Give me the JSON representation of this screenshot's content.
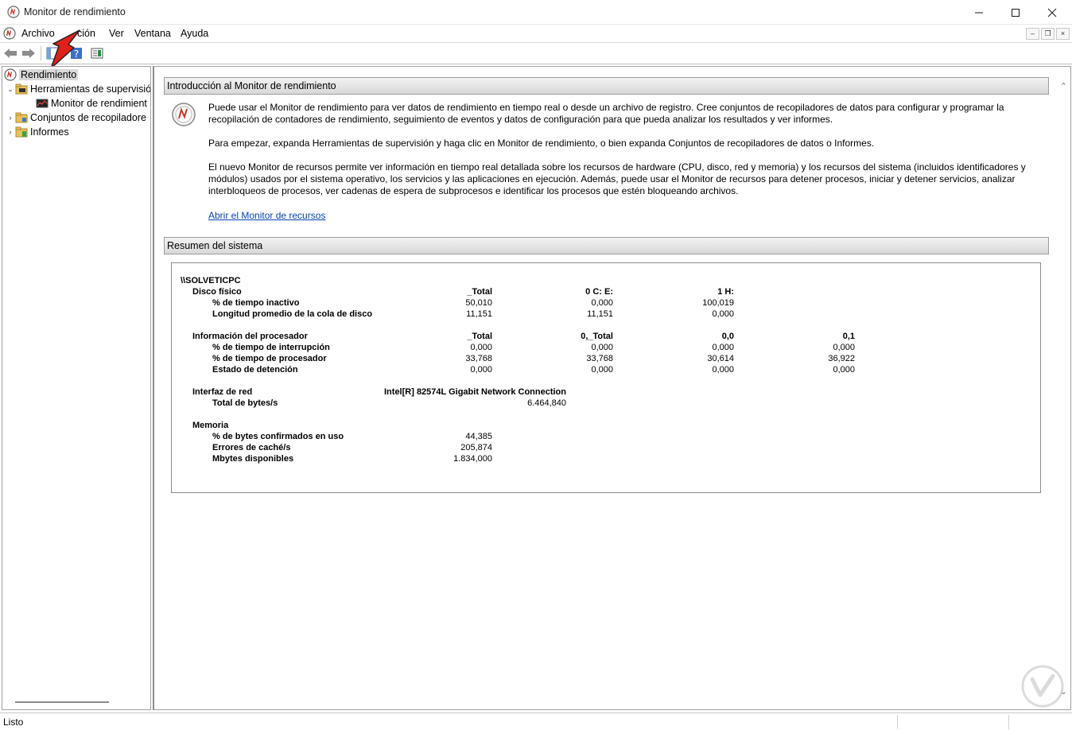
{
  "window": {
    "title": "Monitor de rendimiento"
  },
  "menu": {
    "items": [
      "Archivo",
      "Acción",
      "Ver",
      "Ventana",
      "Ayuda"
    ],
    "visible_items": [
      "Archivo",
      "ción",
      "Ver",
      "Ventana",
      "Ayuda"
    ]
  },
  "tree": {
    "items": [
      {
        "label": "Rendimiento",
        "selected": true
      },
      {
        "label": "Herramientas de supervisió"
      },
      {
        "label": "Monitor de rendimient"
      },
      {
        "label": "Conjuntos de recopiladore"
      },
      {
        "label": "Informes"
      }
    ]
  },
  "intro": {
    "header": "Introducción al Monitor de rendimiento",
    "p1a": "Puede usar el Monitor de rendimiento para ver datos de rendimiento en tiempo real o desde un archivo de registro. Cree conjuntos de recopiladores de datos para configurar y programar la",
    "p1b": "recopilación de contadores de rendimiento, seguimiento de eventos y datos de configuración para que pueda analizar los resultados y ver informes.",
    "p2": "Para empezar, expanda Herramientas de supervisión y haga clic en Monitor de rendimiento, o bien expanda Conjuntos de recopiladores de datos o Informes.",
    "p3a": "El nuevo Monitor de recursos permite ver información en tiempo real detallada sobre los recursos de hardware (CPU, disco, red y memoria) y los recursos del sistema (incluidos identificadores y",
    "p3b": "módulos) usados por el sistema operativo, los servicios y las aplicaciones en ejecución. Además, puede usar el Monitor de recursos para detener procesos, iniciar y detener servicios, analizar",
    "p3c": "interbloqueos de procesos, ver cadenas de espera de subprocesos e identificar los procesos que estén bloqueando archivos.",
    "link": "Abrir el Monitor de recursos"
  },
  "summary": {
    "header": "Resumen del sistema",
    "machine": "\\\\SOLVETICPC",
    "disk": {
      "title": "Disco físico",
      "cols": [
        "_Total",
        "0 C: E:",
        "1 H:"
      ],
      "rows": [
        {
          "label": "% de tiempo inactivo",
          "values": [
            "50,010",
            "0,000",
            "100,019"
          ]
        },
        {
          "label": "Longitud promedio de la cola de disco",
          "values": [
            "11,151",
            "11,151",
            "0,000"
          ]
        }
      ]
    },
    "cpu": {
      "title": "Información del procesador",
      "cols": [
        "_Total",
        "0,_Total",
        "0,0",
        "0,1"
      ],
      "rows": [
        {
          "label": "% de tiempo de interrupción",
          "values": [
            "0,000",
            "0,000",
            "0,000",
            "0,000"
          ]
        },
        {
          "label": "% de tiempo de procesador",
          "values": [
            "33,768",
            "33,768",
            "30,614",
            "36,922"
          ]
        },
        {
          "label": "Estado de detención",
          "values": [
            "0,000",
            "0,000",
            "0,000",
            "0,000"
          ]
        }
      ]
    },
    "net": {
      "title": "Interfaz de red",
      "adapter": "Intel[R] 82574L Gigabit Network Connection",
      "rows": [
        {
          "label": "Total de bytes/s",
          "value": "6.464,840"
        }
      ]
    },
    "memory": {
      "title": "Memoria",
      "rows": [
        {
          "label": "% de bytes confirmados en uso",
          "value": "44,385"
        },
        {
          "label": "Errores de caché/s",
          "value": "205,874"
        },
        {
          "label": "Mbytes disponibles",
          "value": "1.834,000"
        }
      ]
    }
  },
  "status": {
    "text": "Listo"
  },
  "colors": {
    "link": "#0645ad",
    "annotation_arrow": "#e0201b",
    "selection": "#d9d9d9"
  }
}
